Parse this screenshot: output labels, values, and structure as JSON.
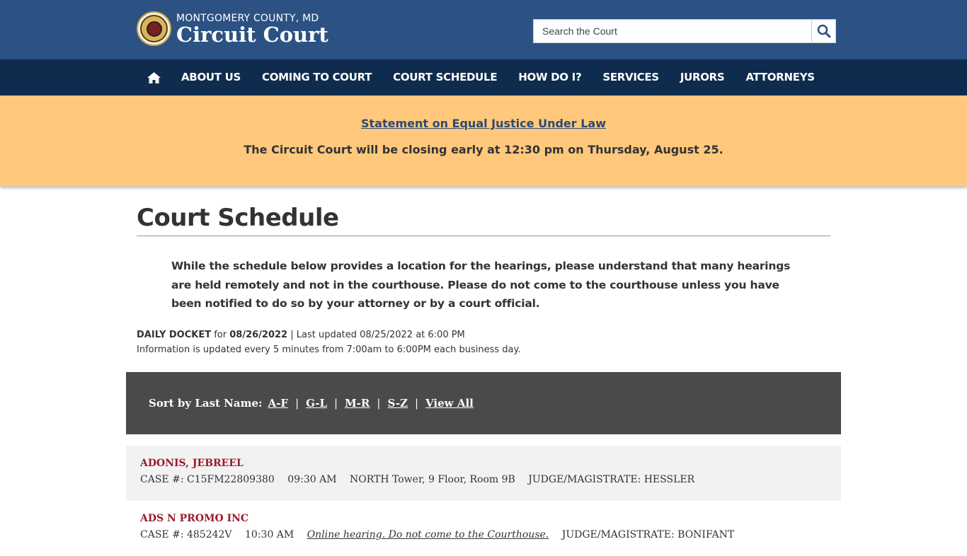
{
  "header": {
    "county": "MONTGOMERY COUNTY, MD",
    "court_name": "Circuit Court",
    "search_placeholder": "Search the Court",
    "brand_color": "#2b5283"
  },
  "nav": {
    "home_icon": "home-icon",
    "items": [
      {
        "label": "ABOUT US"
      },
      {
        "label": "COMING TO COURT"
      },
      {
        "label": "COURT SCHEDULE"
      },
      {
        "label": "HOW DO I?"
      },
      {
        "label": "SERVICES"
      },
      {
        "label": "JURORS"
      },
      {
        "label": "ATTORNEYS"
      }
    ]
  },
  "alert": {
    "link_text": "Statement on Equal Justice Under Law",
    "message": "The Circuit Court will be closing early at 12:30 pm on Thursday, August 25.",
    "background": "#ffc87c"
  },
  "main": {
    "title": "Court Schedule",
    "notice": "While the schedule below provides a location for the hearings, please understand that many hearings are held remotely and not in the courthouse. Please do not come to the courthouse unless you have been notified to do so by your attorney or by a court official.",
    "docket": {
      "label": "DAILY DOCKET",
      "for_text": " for ",
      "date": "08/26/2022",
      "updated": " | Last updated 08/25/2022 at 6:00 PM",
      "info": "Information is updated every 5 minutes from 7:00am to 6:00PM each business day."
    },
    "sort": {
      "label": "Sort by Last Name:",
      "separator": "|",
      "options": [
        "A-F",
        "G-L",
        "M-R",
        "S-Z",
        "View All"
      ]
    },
    "cases": [
      {
        "name": "ADONIS, JEBREEL",
        "case": "CASE #: C15FM22809380",
        "time": "09:30 AM",
        "location": "NORTH Tower, 9 Floor, Room 9B",
        "judge": "JUDGE/MAGISTRATE: HESSLER"
      },
      {
        "name": "ADS N PROMO INC",
        "case": "CASE #: 485242V",
        "time": "10:30 AM",
        "location": "Online hearing. Do not come to the Courthouse.",
        "judge": "JUDGE/MAGISTRATE: BONIFANT"
      }
    ]
  }
}
